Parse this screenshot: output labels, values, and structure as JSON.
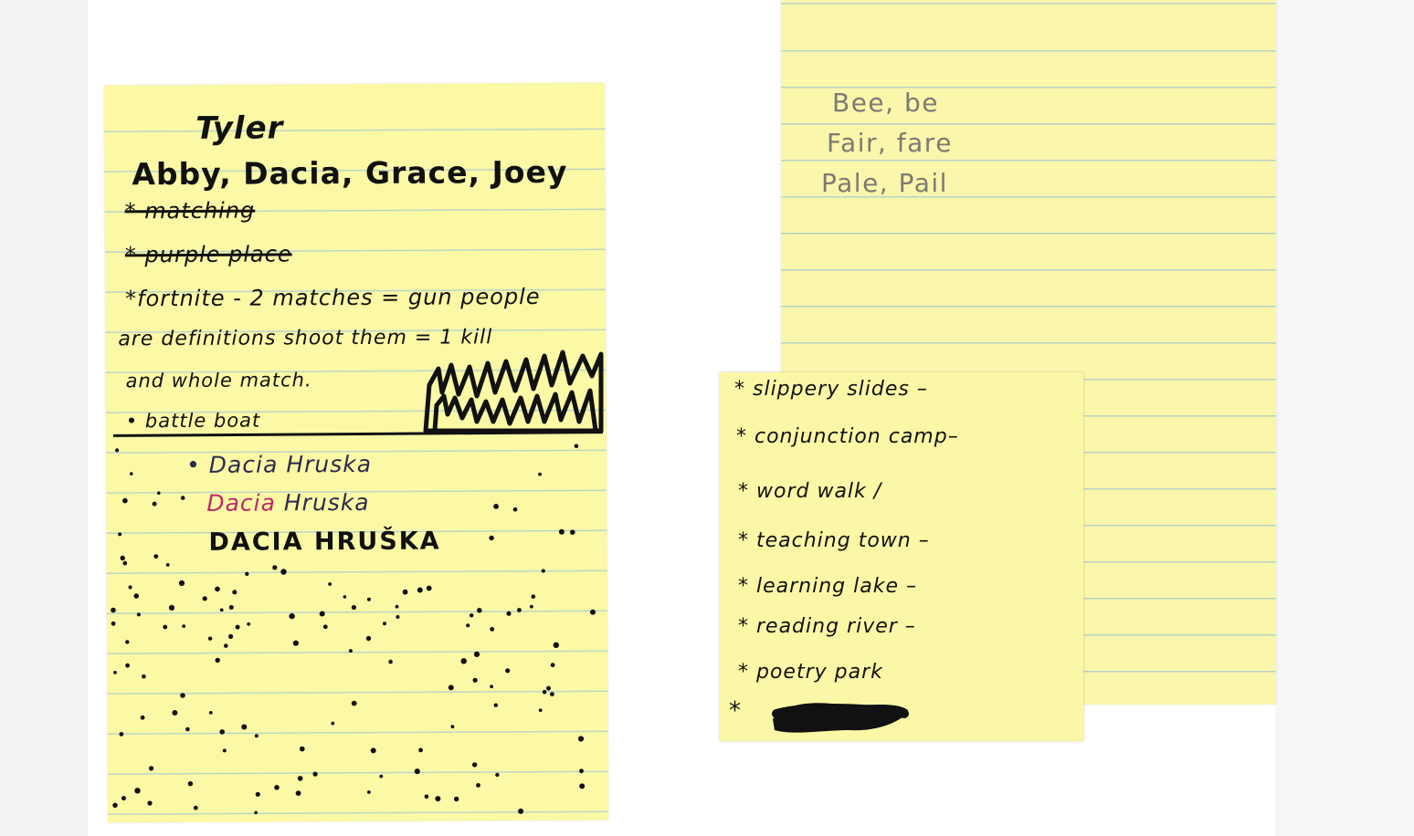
{
  "left_note": {
    "title": "Tyler",
    "names": "Abby, Dacia, Grace, Joey",
    "crossed_1": "* matching",
    "crossed_2": "* purple place",
    "line_1": "*fortnite - 2 matches = gun people",
    "line_2": "are definitions shoot them = 1 kill",
    "line_3": "and whole match.",
    "line_4": "• battle boat",
    "sig_1": "• Dacia Hruska",
    "sig_2_first": "Dacia",
    "sig_2_last": "Hruska",
    "sig_3": "DACIA HRUŠKA"
  },
  "pencil_note": {
    "lines": [
      "Bee, be",
      "Fair, fare",
      "Pale, Pail"
    ]
  },
  "small_note": {
    "items": [
      "* slippery slides –",
      "* conjunction camp–",
      "* word walk /",
      "* teaching town –",
      "* learning lake –",
      "* reading river –",
      "* poetry park",
      "*"
    ]
  },
  "colors": {
    "paper_yellow": "#fbf8a6",
    "rule_line": "#bcd6c6",
    "ink_black": "#111111",
    "ink_navy": "#2c2b4c",
    "ink_pink": "#c0296b",
    "pencil_gray": "#7c7a74"
  }
}
